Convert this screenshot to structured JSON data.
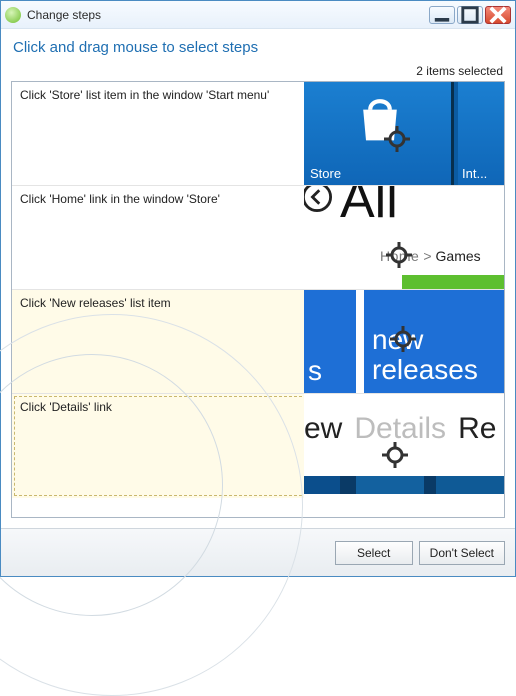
{
  "window": {
    "title": "Change steps"
  },
  "instruction": "Click and drag mouse to select steps",
  "selection_count_text": "2 items selected",
  "steps": [
    {
      "text": "Click 'Store' list item in the window 'Start menu'",
      "selected": false,
      "thumb_labels": {
        "a": "Store",
        "b": "Int..."
      }
    },
    {
      "text": "Click 'Home' link in the window 'Store'",
      "selected": false,
      "thumb_labels": {
        "big": "All",
        "home": "Home",
        "sep": ">",
        "games": "Games"
      }
    },
    {
      "text": "Click 'New releases' list item",
      "selected": true,
      "thumb_labels": {
        "s_tail": "s",
        "new": "new",
        "releases": "releases"
      }
    },
    {
      "text": "Click 'Details' link",
      "selected": true,
      "thumb_labels": {
        "ew": "ew",
        "details": "Details",
        "re": "Re"
      }
    }
  ],
  "buttons": {
    "select": "Select",
    "dont_select": "Don't Select"
  }
}
